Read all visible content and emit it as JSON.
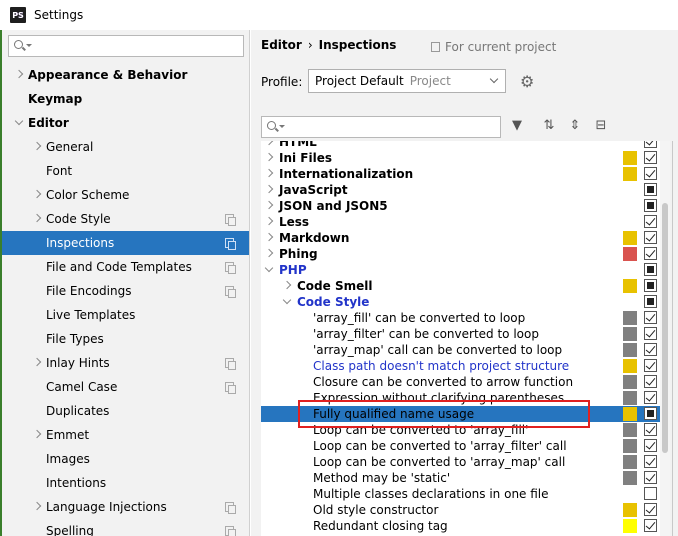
{
  "window": {
    "title": "Settings",
    "app_icon_text": "PS"
  },
  "sidebar": {
    "search_placeholder": "",
    "items": [
      {
        "label": "Appearance & Behavior",
        "bold": true,
        "arrow": "right",
        "indent": 0
      },
      {
        "label": "Keymap",
        "bold": true,
        "arrow": "none",
        "indent": 0
      },
      {
        "label": "Editor",
        "bold": true,
        "arrow": "down",
        "indent": 0
      },
      {
        "label": "General",
        "arrow": "right",
        "indent": 1
      },
      {
        "label": "Font",
        "arrow": "none",
        "indent": 1
      },
      {
        "label": "Color Scheme",
        "arrow": "right",
        "indent": 1
      },
      {
        "label": "Code Style",
        "arrow": "right",
        "indent": 1,
        "copy": true
      },
      {
        "label": "Inspections",
        "arrow": "none",
        "indent": 1,
        "copy": true,
        "selected": true
      },
      {
        "label": "File and Code Templates",
        "arrow": "none",
        "indent": 1,
        "copy": true
      },
      {
        "label": "File Encodings",
        "arrow": "none",
        "indent": 1,
        "copy": true
      },
      {
        "label": "Live Templates",
        "arrow": "none",
        "indent": 1
      },
      {
        "label": "File Types",
        "arrow": "none",
        "indent": 1
      },
      {
        "label": "Inlay Hints",
        "arrow": "right",
        "indent": 1,
        "copy": true
      },
      {
        "label": "Camel Case",
        "arrow": "none",
        "indent": 1,
        "copy": true
      },
      {
        "label": "Duplicates",
        "arrow": "none",
        "indent": 1
      },
      {
        "label": "Emmet",
        "arrow": "right",
        "indent": 1
      },
      {
        "label": "Images",
        "arrow": "none",
        "indent": 1
      },
      {
        "label": "Intentions",
        "arrow": "none",
        "indent": 1
      },
      {
        "label": "Language Injections",
        "arrow": "right",
        "indent": 1,
        "copy": true
      },
      {
        "label": "Spelling",
        "arrow": "none",
        "indent": 1,
        "copy": true
      }
    ]
  },
  "breadcrumb": {
    "parent": "Editor",
    "separator": "›",
    "current": "Inspections"
  },
  "for_project": "For current project",
  "profile": {
    "label": "Profile:",
    "value": "Project Default",
    "scope": "Project"
  },
  "filter": {
    "placeholder": ""
  },
  "colors": {
    "accent": "#2675bf",
    "warning": "#e8c200",
    "error": "#d9534f",
    "weak": "#808080",
    "typo": "#ffff00"
  },
  "tree": [
    {
      "label": "HTML",
      "bold": true,
      "arrow": "right",
      "indent": 0,
      "sev": "",
      "check": "checked",
      "clip": true
    },
    {
      "label": "Ini Files",
      "bold": true,
      "arrow": "right",
      "indent": 0,
      "sev": "warning",
      "check": "checked"
    },
    {
      "label": "Internationalization",
      "bold": true,
      "arrow": "right",
      "indent": 0,
      "sev": "warning",
      "check": "checked"
    },
    {
      "label": "JavaScript",
      "bold": true,
      "arrow": "right",
      "indent": 0,
      "sev": "",
      "check": "partial"
    },
    {
      "label": "JSON and JSON5",
      "bold": true,
      "arrow": "right",
      "indent": 0,
      "sev": "",
      "check": "partial"
    },
    {
      "label": "Less",
      "bold": true,
      "arrow": "right",
      "indent": 0,
      "sev": "",
      "check": "checked"
    },
    {
      "label": "Markdown",
      "bold": true,
      "arrow": "right",
      "indent": 0,
      "sev": "warning",
      "check": "checked"
    },
    {
      "label": "Phing",
      "bold": true,
      "arrow": "right",
      "indent": 0,
      "sev": "error",
      "check": "checked"
    },
    {
      "label": "PHP",
      "bold": true,
      "blue": true,
      "arrow": "down",
      "indent": 0,
      "sev": "",
      "check": "partial"
    },
    {
      "label": "Code Smell",
      "bold": true,
      "arrow": "right",
      "indent": 1,
      "sev": "warning",
      "check": "partial"
    },
    {
      "label": "Code Style",
      "bold": true,
      "blue": true,
      "arrow": "down",
      "indent": 1,
      "sev": "",
      "check": "partial"
    },
    {
      "label": "'array_fill' can be converted to loop",
      "indent": 2,
      "sev": "weak",
      "check": "checked"
    },
    {
      "label": "'array_filter' can be converted to loop",
      "indent": 2,
      "sev": "weak",
      "check": "checked"
    },
    {
      "label": "'array_map' call can be converted to loop",
      "indent": 2,
      "sev": "weak",
      "check": "checked"
    },
    {
      "label": "Class path doesn't match project structure",
      "blue": true,
      "indent": 2,
      "sev": "warning",
      "check": "checked"
    },
    {
      "label": "Closure can be converted to arrow function",
      "indent": 2,
      "sev": "weak",
      "check": "checked"
    },
    {
      "label": "Expression without clarifying parentheses",
      "indent": 2,
      "sev": "weak",
      "check": "checked"
    },
    {
      "label": "Fully qualified name usage",
      "indent": 2,
      "sev": "warning",
      "check": "partial",
      "selected": true
    },
    {
      "label": "Loop can be converted to 'array_fill'",
      "indent": 2,
      "sev": "weak",
      "check": "checked"
    },
    {
      "label": "Loop can be converted to 'array_filter' call",
      "indent": 2,
      "sev": "weak",
      "check": "checked"
    },
    {
      "label": "Loop can be converted to 'array_map' call",
      "indent": 2,
      "sev": "weak",
      "check": "checked"
    },
    {
      "label": "Method may be 'static'",
      "indent": 2,
      "sev": "weak",
      "check": "checked"
    },
    {
      "label": "Multiple classes declarations in one file",
      "indent": 2,
      "sev": "",
      "check": "unchecked"
    },
    {
      "label": "Old style constructor",
      "indent": 2,
      "sev": "warning",
      "check": "checked"
    },
    {
      "label": "Redundant closing tag",
      "indent": 2,
      "sev": "typo",
      "check": "checked"
    }
  ]
}
